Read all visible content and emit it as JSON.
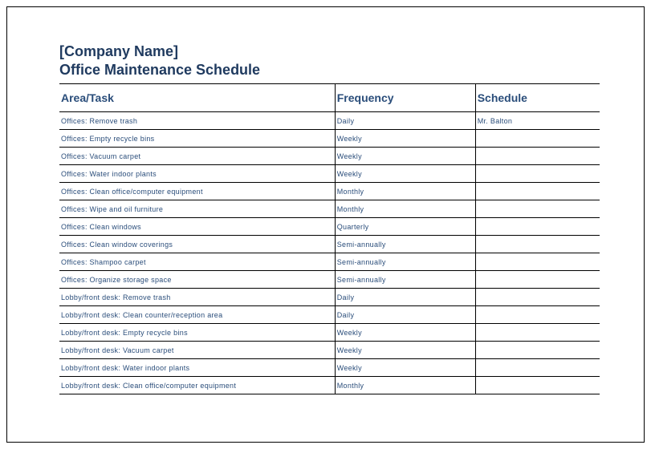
{
  "header": {
    "company_name": "[Company Name]",
    "title": "Office Maintenance Schedule"
  },
  "table": {
    "columns": {
      "area": "Area/Task",
      "frequency": "Frequency",
      "schedule": "Schedule"
    },
    "rows": [
      {
        "area": "Offices: Remove trash",
        "frequency": "Daily",
        "schedule": "Mr. Balton"
      },
      {
        "area": "Offices: Empty recycle bins",
        "frequency": "Weekly",
        "schedule": ""
      },
      {
        "area": "Offices: Vacuum carpet",
        "frequency": "Weekly",
        "schedule": ""
      },
      {
        "area": "Offices: Water indoor plants",
        "frequency": "Weekly",
        "schedule": ""
      },
      {
        "area": "Offices: Clean office/computer equipment",
        "frequency": "Monthly",
        "schedule": ""
      },
      {
        "area": "Offices: Wipe and oil furniture",
        "frequency": "Monthly",
        "schedule": ""
      },
      {
        "area": "Offices: Clean windows",
        "frequency": "Quarterly",
        "schedule": ""
      },
      {
        "area": "Offices: Clean window coverings",
        "frequency": "Semi-annually",
        "schedule": ""
      },
      {
        "area": "Offices: Shampoo carpet",
        "frequency": "Semi-annually",
        "schedule": ""
      },
      {
        "area": "Offices: Organize storage space",
        "frequency": "Semi-annually",
        "schedule": ""
      },
      {
        "area": "Lobby/front desk: Remove trash",
        "frequency": "Daily",
        "schedule": ""
      },
      {
        "area": "Lobby/front desk: Clean counter/reception area",
        "frequency": "Daily",
        "schedule": ""
      },
      {
        "area": "Lobby/front desk: Empty recycle bins",
        "frequency": "Weekly",
        "schedule": ""
      },
      {
        "area": "Lobby/front desk: Vacuum carpet",
        "frequency": "Weekly",
        "schedule": ""
      },
      {
        "area": "Lobby/front desk: Water indoor plants",
        "frequency": "Weekly",
        "schedule": ""
      },
      {
        "area": "Lobby/front desk: Clean office/computer equipment",
        "frequency": "Monthly",
        "schedule": ""
      }
    ]
  }
}
